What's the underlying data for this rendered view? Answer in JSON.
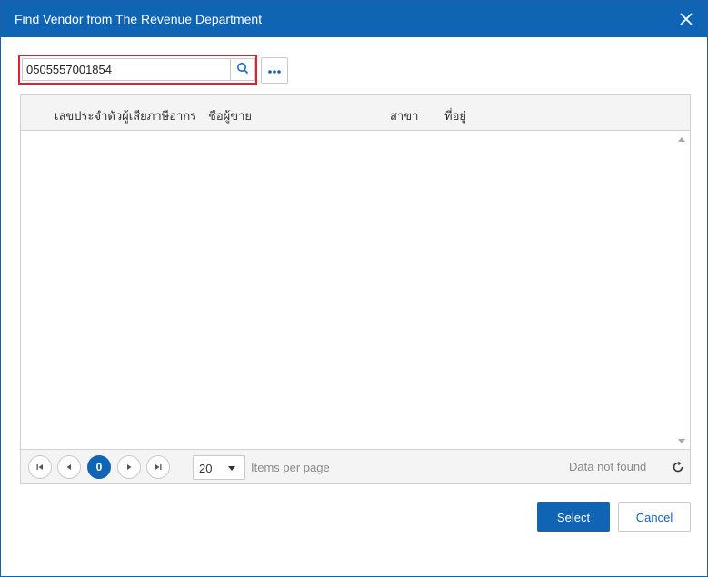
{
  "dialog": {
    "title": "Find Vendor from The Revenue Department",
    "close_icon": "close-icon"
  },
  "search": {
    "value": "0505557001854",
    "search_icon": "search-icon",
    "more_icon": "ellipsis-icon"
  },
  "grid": {
    "columns": [
      "เลขประจำตัวผู้เสียภาษีอากร",
      "ชื่อผู้ขาย",
      "สาขา",
      "ที่อยู่"
    ],
    "rows": []
  },
  "pager": {
    "current_page": "0",
    "page_size": "20",
    "items_per_page_label": "Items per page",
    "status": "Data not found",
    "first_icon": "first-page-icon",
    "prev_icon": "prev-page-icon",
    "next_icon": "next-page-icon",
    "last_icon": "last-page-icon",
    "refresh_icon": "refresh-icon"
  },
  "actions": {
    "select_label": "Select",
    "cancel_label": "Cancel"
  },
  "colors": {
    "primary": "#0f64b4",
    "highlight_border": "#e0202e"
  }
}
